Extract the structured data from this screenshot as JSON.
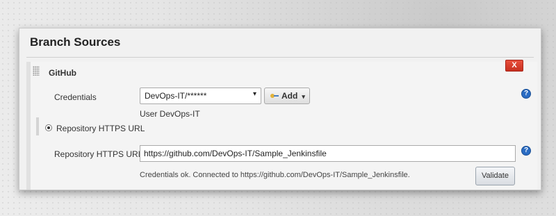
{
  "section": {
    "title": "Branch Sources"
  },
  "source": {
    "name": "GitHub",
    "delete_label": "X"
  },
  "credentials": {
    "label": "Credentials",
    "selected": "DevOps-IT/******",
    "caret": "▾",
    "add_label": "Add",
    "add_caret": "▾",
    "description": "User DevOps-IT",
    "help": "?"
  },
  "repository": {
    "radio_label": "Repository HTTPS URL",
    "field_label": "Repository HTTPS URL",
    "url_value": "https://github.com/DevOps-IT/Sample_Jenkinsfile",
    "status": "Credentials ok. Connected to https://github.com/DevOps-IT/Sample_Jenkinsfile.",
    "validate_label": "Validate",
    "help": "?"
  },
  "colors": {
    "delete_button": "#d63d2b",
    "help_icon": "#2a6cc3"
  },
  "icons": [
    "drag-handle-icon",
    "key-icon",
    "help-icon"
  ]
}
